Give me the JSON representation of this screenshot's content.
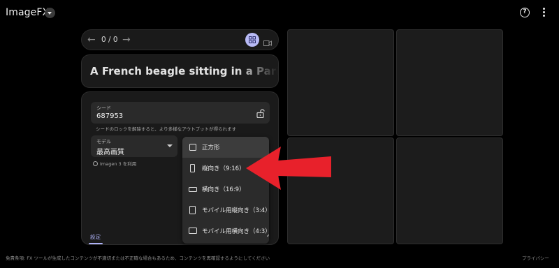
{
  "app": {
    "title": "ImageFX"
  },
  "nav": {
    "counter": "0 / 0"
  },
  "prompt": {
    "text": "A French beagle sitting in a Parisian ca"
  },
  "seed": {
    "label": "シード",
    "value": "687953",
    "hint": "シードのロックを解除すると、より多様なアウトプットが得られます"
  },
  "model": {
    "label": "モデル",
    "value": "最高画質",
    "note": "Imagen 3 を利用"
  },
  "tabs": {
    "settings": "設定"
  },
  "aspect_menu": {
    "items": [
      {
        "label": "正方形",
        "shape": "square"
      },
      {
        "label": "縦向き（9:16）",
        "shape": "portrait"
      },
      {
        "label": "横向き（16:9）",
        "shape": "landscape"
      },
      {
        "label": "モバイル用縦向き（3:4）",
        "shape": "mobile-portrait"
      },
      {
        "label": "モバイル用横向き（4:3）",
        "shape": "mobile-landscape"
      }
    ]
  },
  "footer": {
    "disclaimer": "免責条項: FX ツールが生成したコンテンツが不適切または不正確な場合もあるため、コンテンツを再確認するようにしてください",
    "privacy": "プライバシー"
  },
  "colors": {
    "accent": "#b8baf5",
    "annotation_arrow": "#e8212b",
    "background": "#000000"
  }
}
